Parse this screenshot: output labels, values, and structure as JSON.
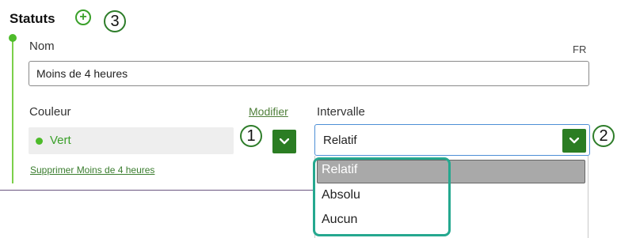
{
  "section": {
    "title": "Statuts",
    "add_icon": "plus-circle-icon"
  },
  "callouts": {
    "one": "1",
    "two": "2",
    "three": "3"
  },
  "name_field": {
    "label": "Nom",
    "language": "FR",
    "value": "Moins de 4 heures"
  },
  "color_field": {
    "label": "Couleur",
    "modify_link": "Modifier",
    "value": "Vert",
    "dot_color": "#4dbb2a"
  },
  "interval_field": {
    "label": "Intervalle",
    "value": "Relatif",
    "options": [
      "Relatif",
      "Absolu",
      "Aucun"
    ],
    "highlighted_option": "Relatif"
  },
  "delete_link": "Supprimer Moins de 4 heures",
  "colors": {
    "accent_green": "#2b7d23",
    "status_green": "#4dbb2a",
    "focus_blue": "#4d8fd6",
    "annotation_teal": "#25a88f"
  }
}
